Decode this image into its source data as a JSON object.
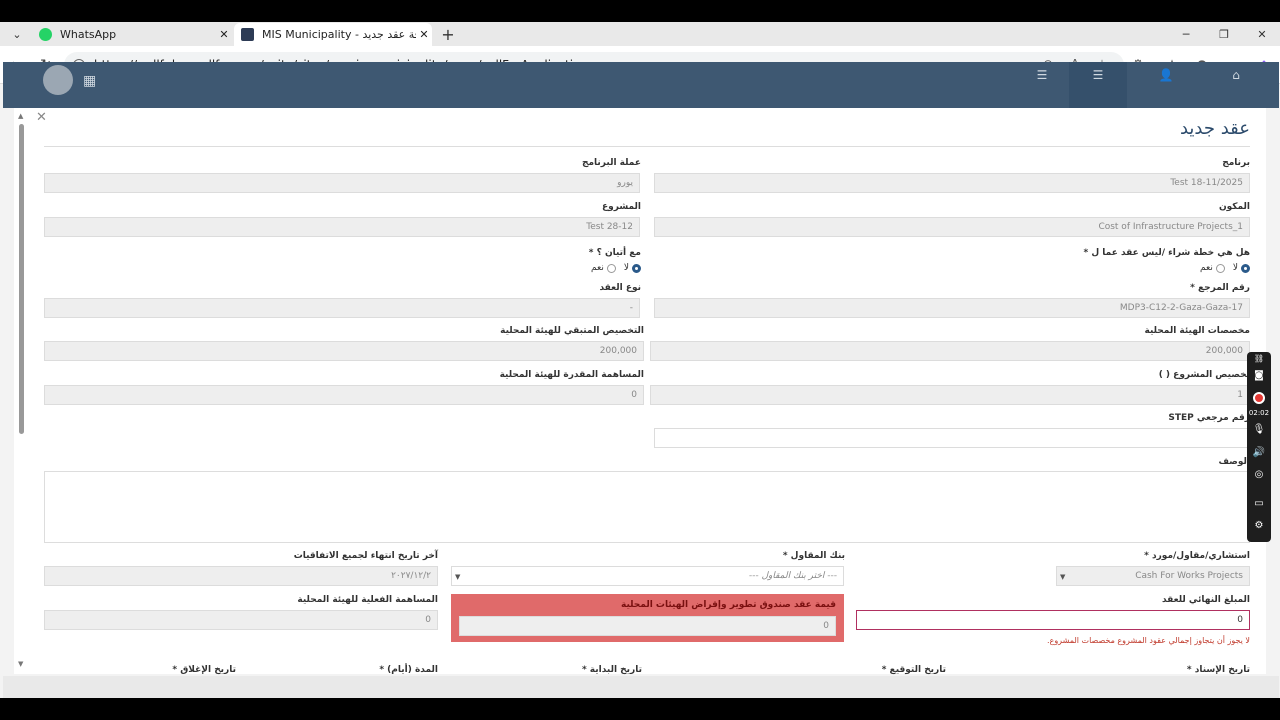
{
  "browser": {
    "tabs": [
      {
        "title": "WhatsApp",
        "favicon_color": "#25D366"
      },
      {
        "title": "MIS Municipality - إضافة عقد جديد",
        "favicon_color": "#2d3b55"
      }
    ],
    "url": "https://mdlf-dev.mdlf.org.ps/suite/sites/pgmis-municipality/page/callForApplication"
  },
  "modal": {
    "title": "عقد جديد",
    "fields": {
      "program_label": "برنامج",
      "program_value": "Test 18-11/2025",
      "currency_label": "عملة البرنامج",
      "currency_value": "يورو",
      "component_label": "المكون",
      "component_value": "Cost of Infrastructure Projects_1",
      "project_label": "المشروع",
      "project_value": "Test 28-12",
      "purchase_plan_label": "هل هي خطة شراء /ليس عقد عما ل *",
      "with_fee_label": "مع أتيان ؟ *",
      "yes": "نعم",
      "no": "لا",
      "ref_no_label": "رقم المرجع *",
      "ref_no_value": "MDP3-C12-2-Gaza-Gaza-17",
      "contract_type_label": "نوع العقد",
      "contract_type_value": "-",
      "lgu_alloc_label": "مخصصات الهيئة المحلية",
      "lgu_alloc_value": "200,000",
      "remaining_alloc_label": "التخصيص المتبقي للهيئة المحلية",
      "remaining_alloc_value": "200,000",
      "project_alloc_label": "تخصيص المشروع ( )",
      "project_alloc_value": "1",
      "est_contrib_label": "المساهمة المقدرة للهيئة المحلية",
      "est_contrib_value": "0",
      "step_ref_label": "رقم مرجعي STEP",
      "description_label": "الوصف",
      "consultant_label": "استشاري/مقاول/مورد *",
      "consultant_value": "Cash For Works Projects",
      "bank_label": "بنك المقاول *",
      "bank_placeholder": "--- اختر بنك المقاول ---",
      "last_end_date_label": "آخر تاريخ انتهاء لجميع الاتفاقيات",
      "last_end_date_value": "٢٠٢٧/١٢/٢",
      "final_amount_label": "المبلغ النهائي للعقد",
      "final_amount_value": "0",
      "mdlf_value_label": "قيمة عقد صندوق تطوير وإقراض الهيئات المحلية",
      "mdlf_value_value": "0",
      "actual_contrib_label": "المساهمة الفعلية للهيئة المحلية",
      "actual_contrib_value": "0",
      "error_msg": "لا يجوز أن يتجاوز إجمالي عقود المشروع مخصصات المشروع.",
      "assign_date_label": "تاريخ الإسناد *",
      "sign_date_label": "تاريخ التوقيع *",
      "start_date_label": "تاريخ البداية *",
      "duration_label": "المدة (أيام) *",
      "close_date_label": "تاريخ الإغلاق *"
    }
  },
  "recorder": {
    "time": "02:02"
  }
}
